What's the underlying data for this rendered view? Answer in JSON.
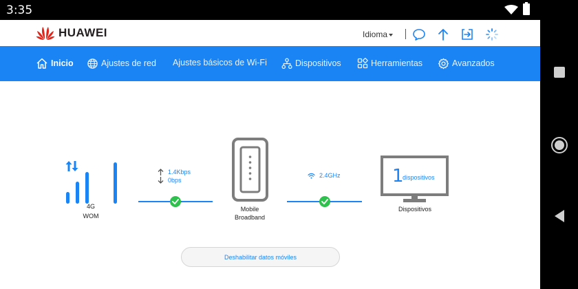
{
  "status_bar": {
    "time": "3:35"
  },
  "header": {
    "brand": "HUAWEI",
    "language_label": "Idioma",
    "accent_color": "#1a84f4"
  },
  "menu": {
    "items": [
      {
        "label": "Inicio",
        "icon": "home-icon",
        "active": true
      },
      {
        "label": "Ajustes de red",
        "icon": "globe-icon",
        "active": false
      },
      {
        "label": "Ajustes básicos de Wi-Fi",
        "icon": "",
        "active": false
      },
      {
        "label": "Dispositivos",
        "icon": "network-icon",
        "active": false
      },
      {
        "label": "Herramientas",
        "icon": "tools-icon",
        "active": false
      },
      {
        "label": "Avanzados",
        "icon": "gear-icon",
        "active": false
      }
    ]
  },
  "dashboard": {
    "signal": {
      "network_type": "4G",
      "operator": "WOM",
      "bars": 4
    },
    "traffic": {
      "upload": "1.4Kbps",
      "download": "0bps",
      "status": "connected"
    },
    "router": {
      "label_line1": "Mobile",
      "label_line2": "Broadband"
    },
    "wifi": {
      "band": "2.4GHz",
      "status": "connected"
    },
    "devices": {
      "count": "1",
      "unit": "dispositivos",
      "label": "Dispositivos"
    },
    "disable_button_label": "Deshabilitar datos móviles"
  },
  "colors": {
    "accent": "#1a84f4",
    "success": "#2ec14d",
    "device_gray": "#7d7d7d"
  }
}
